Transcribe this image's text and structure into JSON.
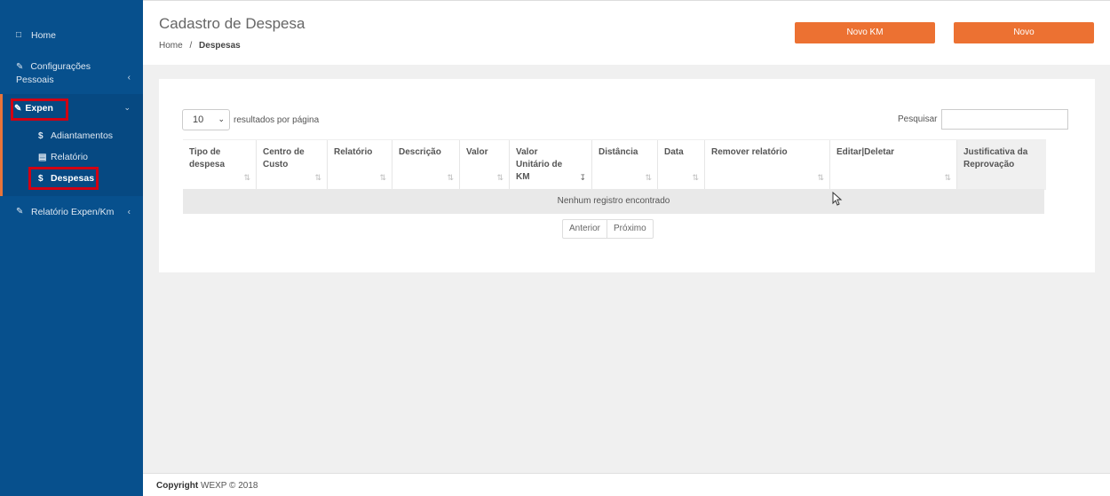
{
  "sidebar": {
    "home": "Home",
    "configuracoes": "Configurações Pessoais",
    "expen": "Expen",
    "adiantamentos": "Adiantamentos",
    "relatorio": "Relatório",
    "despesas": "Despesas",
    "relatorio_expen": "Relatório Expen/Km"
  },
  "header": {
    "title": "Cadastro de Despesa",
    "breadcrumb_home": "Home",
    "breadcrumb_sep": "/",
    "breadcrumb_current": "Despesas",
    "btn_novo_km": "Novo KM",
    "btn_novo": "Novo"
  },
  "table_controls": {
    "page_length": "10",
    "page_length_label": "resultados por página",
    "search_label": "Pesquisar",
    "search_value": ""
  },
  "table": {
    "columns": [
      "Tipo de despesa",
      "Centro de Custo",
      "Relatório",
      "Descrição",
      "Valor",
      "Valor Unitário de KM",
      "Distância",
      "Data",
      "Remover relatório",
      "Editar|Deletar",
      "Justificativa da Reprovação"
    ],
    "empty_message": "Nenhum registro encontrado"
  },
  "pagination": {
    "prev": "Anterior",
    "next": "Próximo"
  },
  "footer": {
    "copyright_bold": "Copyright",
    "copyright_rest": "WEXP © 2018"
  },
  "colors": {
    "sidebar": "#07508d",
    "accent": "#ec7132",
    "highlight": "#d10013"
  }
}
